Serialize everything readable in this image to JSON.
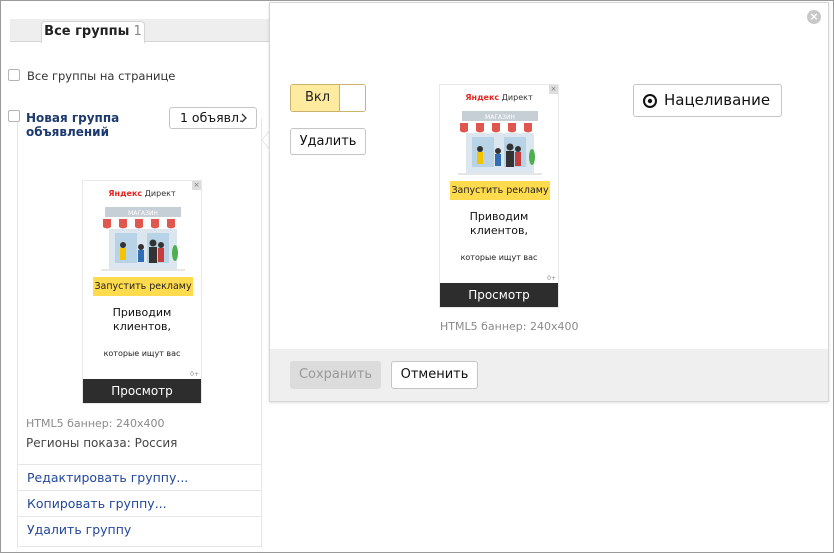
{
  "tabs": [
    {
      "label": "Все группы",
      "count": "1"
    }
  ],
  "select_all_label": "Все группы на странице",
  "group": {
    "title": "Новая группа объявлений",
    "ads_button_label": "1 объявл.",
    "banner_meta": "HTML5 баннер: 240x400",
    "regions": "Регионы показа: Россия",
    "actions": [
      "Редактировать группу...",
      "Копировать группу...",
      "Удалить группу"
    ]
  },
  "banner": {
    "logo_brand": "Яндекс",
    "logo_product": "Директ",
    "close_mark": "×",
    "shop_sign": "МАГАЗИН",
    "cta": "Запустить рекламу",
    "headline_line1": "Приводим",
    "headline_line2": "клиентов,",
    "subtext": "которые ищут вас",
    "age": "0+",
    "view_label": "Просмотр"
  },
  "editor": {
    "toggle_label": "Вкл",
    "delete_label": "Удалить",
    "targeting_label": "Нацеливание",
    "banner_meta": "HTML5 баннер: 240x400",
    "save_label": "Сохранить",
    "cancel_label": "Отменить",
    "close_symbol": "×"
  },
  "colors": {
    "accent_yellow": "#ffdb4d",
    "toggle_bg": "#ffeba0",
    "link_blue": "#23479c",
    "title_blue": "#1d3a6e",
    "awning_red": "#e0574f"
  },
  "icons": {
    "targeting": "target-icon",
    "close": "close-icon",
    "chevron": "chevron-right-icon"
  }
}
